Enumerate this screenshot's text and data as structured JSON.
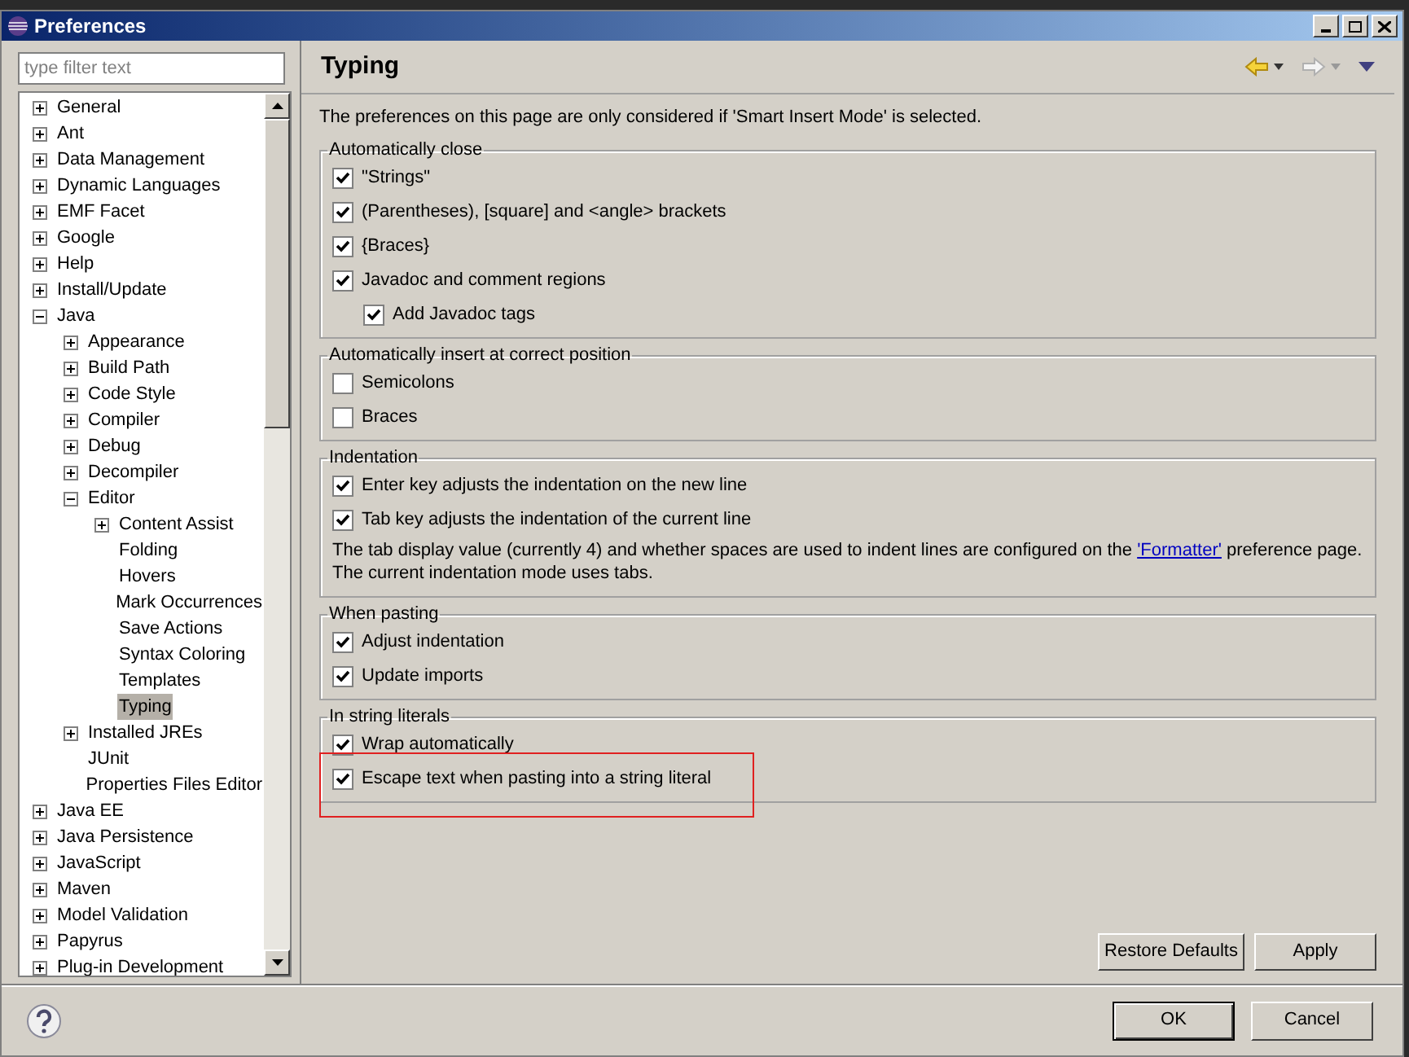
{
  "window": {
    "title": "Preferences"
  },
  "filter": {
    "placeholder": "type filter text"
  },
  "tree": [
    {
      "label": "General",
      "selected": false,
      "expanded": false
    },
    {
      "label": "Ant",
      "selected": false,
      "expanded": false
    },
    {
      "label": "Data Management",
      "selected": false,
      "expanded": false
    },
    {
      "label": "Dynamic Languages",
      "selected": false,
      "expanded": false
    },
    {
      "label": "EMF Facet",
      "selected": false,
      "expanded": false
    },
    {
      "label": "Google",
      "selected": false,
      "expanded": false
    },
    {
      "label": "Help",
      "selected": false,
      "expanded": false
    },
    {
      "label": "Install/Update",
      "selected": false,
      "expanded": false
    },
    {
      "label": "Java",
      "selected": false,
      "expanded": true,
      "children": [
        {
          "label": "Appearance",
          "selected": false,
          "expanded": false
        },
        {
          "label": "Build Path",
          "selected": false,
          "expanded": false
        },
        {
          "label": "Code Style",
          "selected": false,
          "expanded": false
        },
        {
          "label": "Compiler",
          "selected": false,
          "expanded": false
        },
        {
          "label": "Debug",
          "selected": false,
          "expanded": false
        },
        {
          "label": "Decompiler",
          "selected": false,
          "expanded": false
        },
        {
          "label": "Editor",
          "selected": false,
          "expanded": true,
          "children": [
            {
              "label": "Content Assist",
              "selected": false,
              "expanded": false
            },
            {
              "label": "Folding",
              "selected": false
            },
            {
              "label": "Hovers",
              "selected": false
            },
            {
              "label": "Mark Occurrences",
              "selected": false
            },
            {
              "label": "Save Actions",
              "selected": false
            },
            {
              "label": "Syntax Coloring",
              "selected": false
            },
            {
              "label": "Templates",
              "selected": false
            },
            {
              "label": "Typing",
              "selected": true
            }
          ]
        },
        {
          "label": "Installed JREs",
          "selected": false,
          "expanded": false
        },
        {
          "label": "JUnit",
          "selected": false
        },
        {
          "label": "Properties Files Editor",
          "selected": false
        }
      ]
    },
    {
      "label": "Java EE",
      "selected": false,
      "expanded": false
    },
    {
      "label": "Java Persistence",
      "selected": false,
      "expanded": false
    },
    {
      "label": "JavaScript",
      "selected": false,
      "expanded": false
    },
    {
      "label": "Maven",
      "selected": false,
      "expanded": false
    },
    {
      "label": "Model Validation",
      "selected": false,
      "expanded": false
    },
    {
      "label": "Papyrus",
      "selected": false,
      "expanded": false
    },
    {
      "label": "Plug-in Development",
      "selected": false,
      "expanded": false
    }
  ],
  "page": {
    "title": "Typing",
    "description": "The preferences on this page are only considered if 'Smart Insert Mode' is selected.",
    "groups": [
      {
        "title": "Automatically close",
        "options": [
          {
            "label": "\"Strings\"",
            "checked": true,
            "highlighted": false
          },
          {
            "label": "(Parentheses), [square] and <angle> brackets",
            "checked": true,
            "highlighted": false
          },
          {
            "label": "{Braces}",
            "checked": true,
            "highlighted": false
          },
          {
            "label": "Javadoc and comment regions",
            "checked": true,
            "highlighted": false,
            "children": [
              {
                "label": "Add Javadoc tags",
                "checked": true,
                "highlighted": false
              }
            ]
          }
        ]
      },
      {
        "title": "Automatically insert at correct position",
        "options": [
          {
            "label": "Semicolons",
            "checked": false,
            "highlighted": false
          },
          {
            "label": "Braces",
            "checked": false,
            "highlighted": false
          }
        ]
      },
      {
        "title": "Indentation",
        "options": [
          {
            "label": "Enter key adjusts the indentation on the new line",
            "checked": true,
            "highlighted": false
          },
          {
            "label": "Tab key adjusts the indentation of the current line",
            "checked": true,
            "highlighted": false
          }
        ],
        "note": {
          "before": "The tab display value (currently 4) and whether spaces are used to indent lines are configured on the ",
          "link": "'Formatter'",
          "after": " preference page."
        },
        "note_2": "The current indentation mode uses tabs."
      },
      {
        "title": "When pasting",
        "options": [
          {
            "label": "Adjust indentation",
            "checked": true,
            "highlighted": false
          },
          {
            "label": "Update imports",
            "checked": true,
            "highlighted": false
          }
        ]
      },
      {
        "title": "In string literals",
        "options": [
          {
            "label": "Wrap automatically",
            "checked": true,
            "highlighted": false
          },
          {
            "label": "Escape text when pasting into a string literal",
            "checked": true,
            "highlighted": true
          }
        ]
      }
    ],
    "buttons": [
      "Restore Defaults",
      "Apply"
    ]
  },
  "footer_buttons": [
    {
      "label": "OK",
      "default": true
    },
    {
      "label": "Cancel",
      "default": false
    }
  ]
}
